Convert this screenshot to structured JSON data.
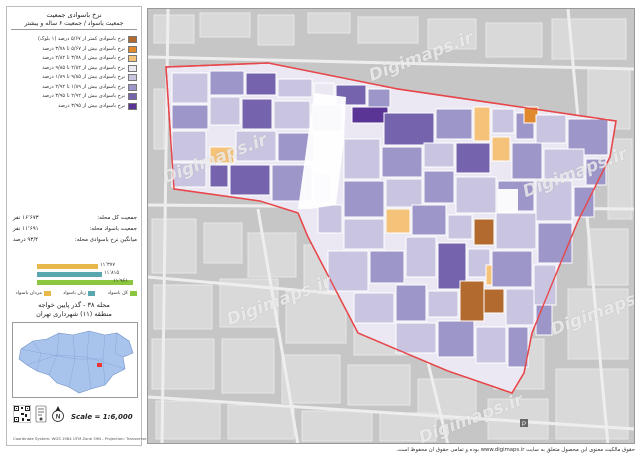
{
  "legend": {
    "title": "نرخ باسوادی جمعیت",
    "subtitle": "جمعیت باسواد / جمعیت ۶ ساله و بیشتر",
    "items": [
      {
        "label": "نرخ باسوادی کمتر از ۵/۶۷ درصد (۱ بلوک)",
        "color": "#b36a2e"
      },
      {
        "label": "نرخ باسوادی بیش از ۵/۶۷ تا ۳/۷۸ درصد",
        "color": "#e0892d"
      },
      {
        "label": "نرخ باسوادی بیش از ۳/۷۸ تا ۲/۸۲ درصد",
        "color": "#f5c27a"
      },
      {
        "label": "نرخ باسوادی بیش از ۲/۸۲ تا ۹/۸۵ درصد",
        "color": "#ebe8f3"
      },
      {
        "label": "نرخ باسوادی بیش از ۹/۸۵ تا ۱/۸۹ درصد",
        "color": "#c9c5e0"
      },
      {
        "label": "نرخ باسوادی بیش از ۱/۸۹ تا ۲/۹۲ درصد",
        "color": "#9d96c8"
      },
      {
        "label": "نرخ باسوادی بیش از ۲/۹۲ تا ۳/۹۵ درصد",
        "color": "#7563ad"
      },
      {
        "label": "نرخ باسوادی بیش از ۳/۹۵ درصد",
        "color": "#5a3596"
      }
    ]
  },
  "stats": {
    "total_population_label": "جمعیت کل محله:",
    "total_population_value": "۱۶٬۶۷۳ نفر",
    "literate_population_label": "جمعیت باسواد محله:",
    "literate_population_value": "۱۱٬۶۹۱ نفر",
    "literacy_rate_label": "میانگین نرخ باسوادی محله:",
    "literacy_rate_value": "۹۳/۴ درصد"
  },
  "bar_chart": {
    "values": [
      {
        "label": "۱۱٬۳۷۷",
        "fraction": 0.62,
        "color": "#e8b94a"
      },
      {
        "label": "۱۱٬۸۱۵",
        "fraction": 0.66,
        "color": "#5aa7b0"
      },
      {
        "label": "۱۱٬۹۶۱",
        "fraction": 0.98,
        "color": "#8cc63f"
      }
    ],
    "legend": [
      {
        "label": "مردان باسواد",
        "color": "#e8b94a"
      },
      {
        "label": "زنان باسواد",
        "color": "#5aa7b0"
      },
      {
        "label": "کل باسواد",
        "color": "#8cc63f"
      }
    ]
  },
  "district": {
    "line1": "محله ۳۸ - گذر پایین خواجه",
    "line2": "منطقه (۱۱) شهرداری تهران"
  },
  "scale_text": "Scale = 1:6,000",
  "coord_note": "Coordinate System: WGS 1984 UTM Zone 39N - Projection: Transverse Mercator",
  "watermark": "Digimaps.ir",
  "copyright": "حقوق مالکیت معنوی این محصول متعلق به سایت www.digimaps.ir بوده و تمامی حقوق آن محفوظ است."
}
